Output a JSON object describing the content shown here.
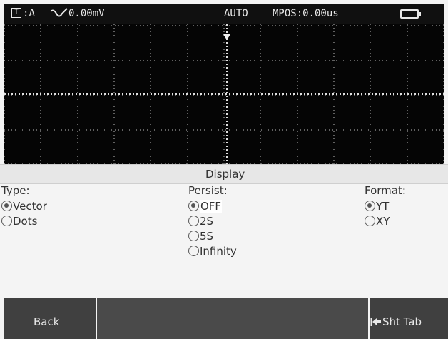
{
  "status_bar": {
    "trigger_source": "A",
    "trigger_level": "0.00mV",
    "mode": "AUTO",
    "mpos": "MPOS:0.00us"
  },
  "menu": {
    "title": "Display",
    "type": {
      "label": "Type:",
      "options": [
        {
          "label": "Vector",
          "selected": true
        },
        {
          "label": "Dots",
          "selected": false
        }
      ]
    },
    "persist": {
      "label": "Persist:",
      "options": [
        {
          "label": "OFF",
          "selected": true
        },
        {
          "label": "2S",
          "selected": false
        },
        {
          "label": "5S",
          "selected": false
        },
        {
          "label": "Infinity",
          "selected": false
        }
      ]
    },
    "format": {
      "label": "Format:",
      "options": [
        {
          "label": "YT",
          "selected": true
        },
        {
          "label": "XY",
          "selected": false
        }
      ]
    }
  },
  "softkeys": {
    "back": "Back",
    "shift_tab": "Sht Tab"
  },
  "colors": {
    "screen_bg": "#050505",
    "grid_dots": "#bdbdbd",
    "panel_bg": "#f4f4f4",
    "softkey_bg": "#404040"
  }
}
